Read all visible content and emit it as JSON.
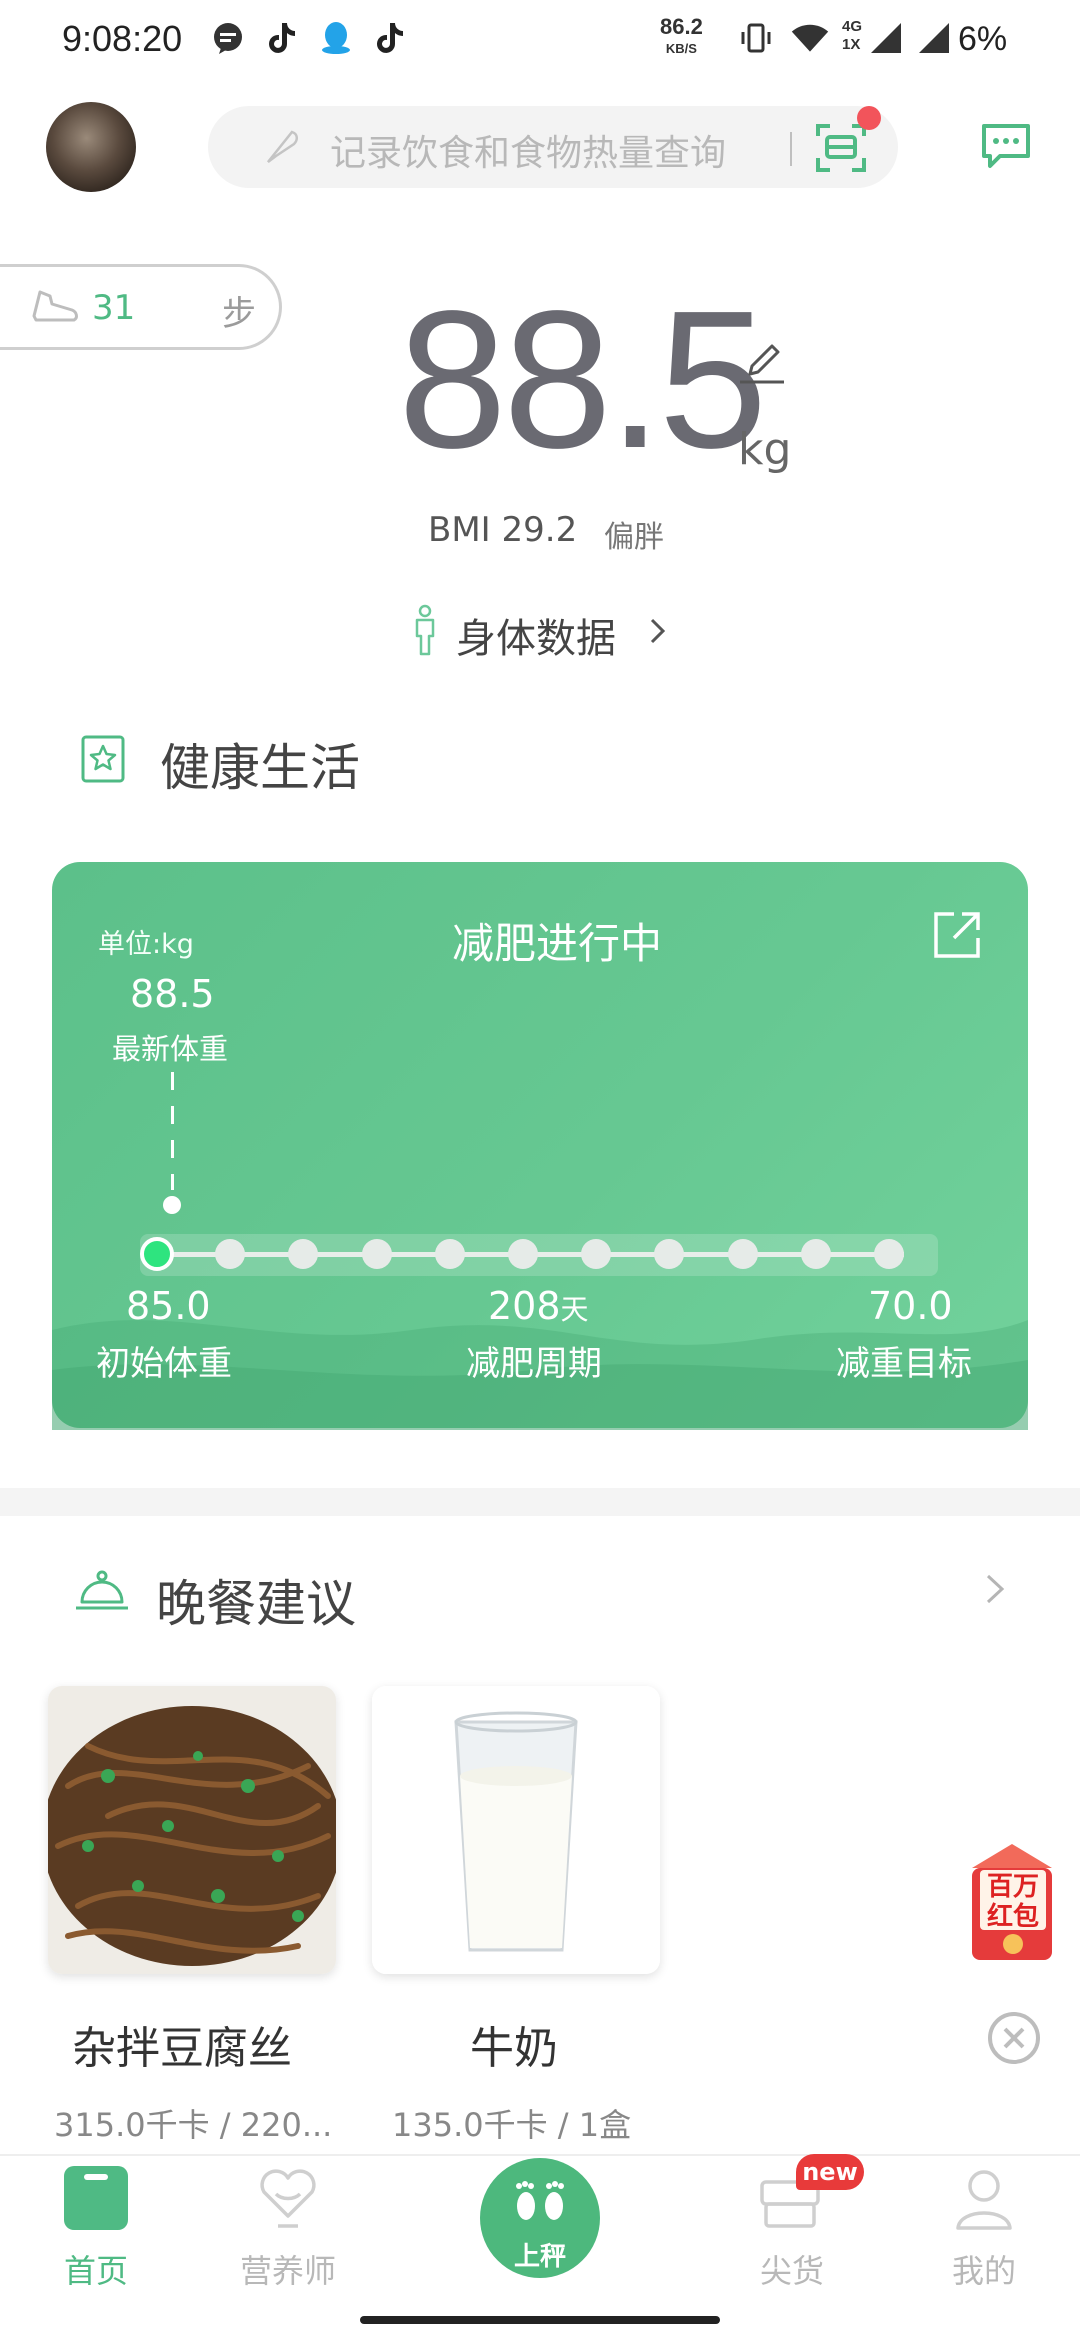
{
  "status_bar": {
    "time": "9:08:20",
    "network_speed": "86.2",
    "network_unit": "KB/S",
    "network_type_top": "4G",
    "network_type_bottom": "1X",
    "battery": "6%"
  },
  "header": {
    "search_placeholder": "记录饮食和食物热量查询"
  },
  "steps": {
    "count": "31",
    "unit": "步"
  },
  "weight": {
    "value": "88.5",
    "unit": "kg",
    "bmi_label": "BMI",
    "bmi_value": "29.2",
    "bmi_status": "偏胖",
    "body_data_link": "身体数据"
  },
  "healthy_life": {
    "title": "健康生活"
  },
  "weight_loss_card": {
    "unit_label": "单位:kg",
    "title": "减肥进行中",
    "latest_weight": "88.5",
    "latest_weight_label": "最新体重",
    "initial_weight": "85.0",
    "initial_weight_label": "初始体重",
    "cycle_days": "208",
    "cycle_unit": "天",
    "cycle_label": "减肥周期",
    "target_weight": "70.0",
    "target_weight_label": "减重目标",
    "progress_nodes": 11
  },
  "dinner": {
    "title": "晚餐建议",
    "items": [
      {
        "name": "杂拌豆腐丝",
        "info": "315.0千卡 / 220..."
      },
      {
        "name": "牛奶",
        "info": "135.0千卡 / 1盒"
      }
    ]
  },
  "promo": {
    "line1": "百万",
    "line2": "红包"
  },
  "bottom_nav": {
    "items": [
      {
        "label": "首页",
        "active": true
      },
      {
        "label": "营养师",
        "active": false
      },
      {
        "label": "上秤",
        "active": false
      },
      {
        "label": "尖货",
        "active": false,
        "badge": "new"
      },
      {
        "label": "我的",
        "active": false
      }
    ]
  },
  "colors": {
    "accent": "#4fba84",
    "card_green": "#66c892",
    "badge_red": "#e83a3a"
  }
}
